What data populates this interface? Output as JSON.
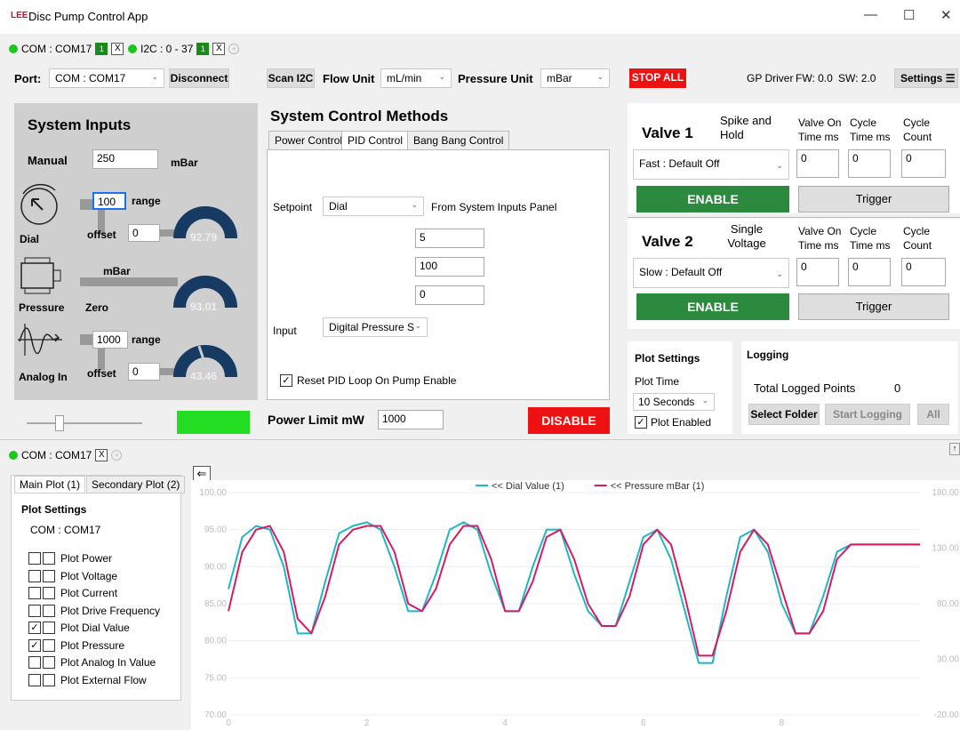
{
  "window": {
    "title": "Disc Pump Control App",
    "logo_text": "LEE"
  },
  "tabs": [
    {
      "label": "COM : COM17",
      "badge": "1",
      "close": "X"
    },
    {
      "label": "I2C : 0 - 37",
      "badge": "1",
      "close": "X"
    }
  ],
  "toolbar": {
    "port_label": "Port:",
    "port_value": "COM : COM17",
    "disconnect": "Disconnect",
    "scan_i2c": "Scan I2C",
    "flow_unit_label": "Flow Unit",
    "flow_unit_value": "mL/min",
    "pressure_unit_label": "Pressure Unit",
    "pressure_unit_value": "mBar",
    "stop_all": "STOP ALL",
    "gp_driver": "GP Driver",
    "fw": "FW: 0.0",
    "sw": "SW: 2.0",
    "settings": "Settings"
  },
  "system_inputs": {
    "title": "System Inputs",
    "manual_label": "Manual",
    "manual_value": "250",
    "manual_unit": "mBar",
    "dial_label": "Dial",
    "dial_range_value": "100",
    "range_label": "range",
    "offset_label": "offset",
    "dial_offset_value": "0",
    "dial_gauge": "92.79",
    "pressure_label": "Pressure",
    "pressure_unit": "mBar",
    "zero_label": "Zero",
    "pressure_gauge": "93.01",
    "analog_label": "Analog In",
    "analog_range_value": "1000",
    "analog_offset_value": "0",
    "analog_gauge": "43.46",
    "gauges": {
      "dial_level": 0.93,
      "pressure_level": 0.93,
      "analog_level": 0.43
    }
  },
  "control": {
    "title": "System Control Methods",
    "tabs": [
      "Power Control",
      "PID Control",
      "Bang Bang Control"
    ],
    "setpoint_label": "Setpoint",
    "setpoint_value": "Dial",
    "setpoint_note": "From System Inputs Panel",
    "pid_values": [
      "5",
      "100",
      "0"
    ],
    "input_label": "Input",
    "input_value": "Digital Pressure S",
    "reset_checkbox": "Reset PID Loop On Pump Enable",
    "power_limit_label": "Power Limit mW",
    "power_limit_value": "1000",
    "disable": "DISABLE"
  },
  "valves": [
    {
      "title": "Valve 1",
      "mode": "Spike and Hold",
      "h1": "Valve On Time ms",
      "h2": "Cycle Time ms",
      "h3": "Cycle Count",
      "select": "Fast : Default Off",
      "v1": "0",
      "v2": "0",
      "v3": "0",
      "enable": "ENABLE",
      "trigger": "Trigger"
    },
    {
      "title": "Valve 2",
      "mode": "Single Voltage",
      "h1": "Valve On Time ms",
      "h2": "Cycle Time ms",
      "h3": "Cycle Count",
      "select": "Slow : Default Off",
      "v1": "0",
      "v2": "0",
      "v3": "0",
      "enable": "ENABLE",
      "trigger": "Trigger"
    }
  ],
  "plot_settings": {
    "title": "Plot Settings",
    "time_label": "Plot Time",
    "time_value": "10 Seconds",
    "enabled_label": "Plot Enabled"
  },
  "logging": {
    "title": "Logging",
    "total_label": "Total Logged Points",
    "total_value": "0",
    "select_folder": "Select Folder",
    "start_logging": "Start Logging",
    "all": "All"
  },
  "lower_tab": {
    "label": "COM : COM17",
    "close": "X"
  },
  "plot_tabs": [
    "Main Plot (1)",
    "Secondary Plot (2)"
  ],
  "plot_side": {
    "title": "Plot Settings",
    "port": "COM : COM17",
    "items": [
      {
        "label": "Plot Power",
        "c1": false,
        "c2": false
      },
      {
        "label": "Plot Voltage",
        "c1": false,
        "c2": false
      },
      {
        "label": "Plot Current",
        "c1": false,
        "c2": false
      },
      {
        "label": "Plot Drive Frequency",
        "c1": false,
        "c2": false
      },
      {
        "label": "Plot Dial Value",
        "c1": true,
        "c2": false
      },
      {
        "label": "Plot Pressure",
        "c1": true,
        "c2": false
      },
      {
        "label": "Plot Analog In Value",
        "c1": false,
        "c2": false
      },
      {
        "label": "Plot External Flow",
        "c1": false,
        "c2": false
      }
    ]
  },
  "colors": {
    "dial": "#1fb5c9",
    "pressure": "#d81b60",
    "stop": "#ee1111",
    "enable": "#2b8a3e",
    "gauge": "#173a63"
  },
  "chart_data": {
    "type": "line",
    "legend": [
      "<< Dial Value (1)",
      "<< Pressure mBar (1)"
    ],
    "y_left_ticks": [
      "100.00",
      "95.00",
      "90.00",
      "85.00",
      "80.00",
      "75.00",
      "70.00"
    ],
    "y_right_ticks": [
      "180.00",
      "130.00",
      "80.00",
      "30.00",
      "-20.00"
    ],
    "x_ticks": [
      "0",
      "2",
      "4",
      "6",
      "8"
    ],
    "xlim": [
      0,
      10
    ],
    "ylim": [
      70,
      100
    ],
    "series": [
      {
        "name": "<< Dial Value (1)",
        "x": [
          0,
          0.2,
          0.4,
          0.6,
          0.8,
          1.0,
          1.2,
          1.4,
          1.6,
          1.8,
          2.0,
          2.2,
          2.4,
          2.6,
          2.8,
          3.0,
          3.2,
          3.4,
          3.6,
          3.8,
          4.0,
          4.2,
          4.4,
          4.6,
          4.8,
          5.0,
          5.2,
          5.4,
          5.6,
          5.8,
          6.0,
          6.2,
          6.4,
          6.6,
          6.8,
          7.0,
          7.2,
          7.4,
          7.6,
          7.8,
          8.0,
          8.2,
          8.4,
          8.6,
          8.8,
          9.0,
          9.2,
          9.4,
          9.6,
          9.8,
          10.0
        ],
        "y": [
          87,
          94,
          95.5,
          95,
          90,
          81,
          81,
          88,
          94.5,
          95.5,
          96,
          95,
          90,
          84,
          84,
          89,
          95,
          96,
          95,
          89,
          84,
          84,
          90,
          95,
          95,
          89,
          84,
          82,
          82,
          88,
          94,
          95,
          91,
          84,
          77,
          77,
          86,
          94,
          95,
          92,
          85,
          81,
          81,
          86,
          92,
          93,
          93,
          93,
          93,
          93,
          93
        ]
      },
      {
        "name": "<< Pressure mBar (1)",
        "x": [
          0,
          0.2,
          0.4,
          0.6,
          0.8,
          1.0,
          1.2,
          1.4,
          1.6,
          1.8,
          2.0,
          2.2,
          2.4,
          2.6,
          2.8,
          3.0,
          3.2,
          3.4,
          3.6,
          3.8,
          4.0,
          4.2,
          4.4,
          4.6,
          4.8,
          5.0,
          5.2,
          5.4,
          5.6,
          5.8,
          6.0,
          6.2,
          6.4,
          6.6,
          6.8,
          7.0,
          7.2,
          7.4,
          7.6,
          7.8,
          8.0,
          8.2,
          8.4,
          8.6,
          8.8,
          9.0,
          9.2,
          9.4,
          9.6,
          9.8,
          10.0
        ],
        "y": [
          84,
          92,
          95,
          95.5,
          92,
          83,
          81,
          86,
          93,
          95,
          95.5,
          95.5,
          92,
          85,
          84,
          87,
          93,
          95.5,
          95.5,
          91,
          84,
          84,
          88,
          94,
          95,
          91,
          85,
          82,
          82,
          86,
          93,
          95,
          93,
          86,
          78,
          78,
          84,
          92,
          95,
          93,
          87,
          81,
          81,
          84,
          91,
          93,
          93,
          93,
          93,
          93,
          93
        ]
      }
    ]
  }
}
